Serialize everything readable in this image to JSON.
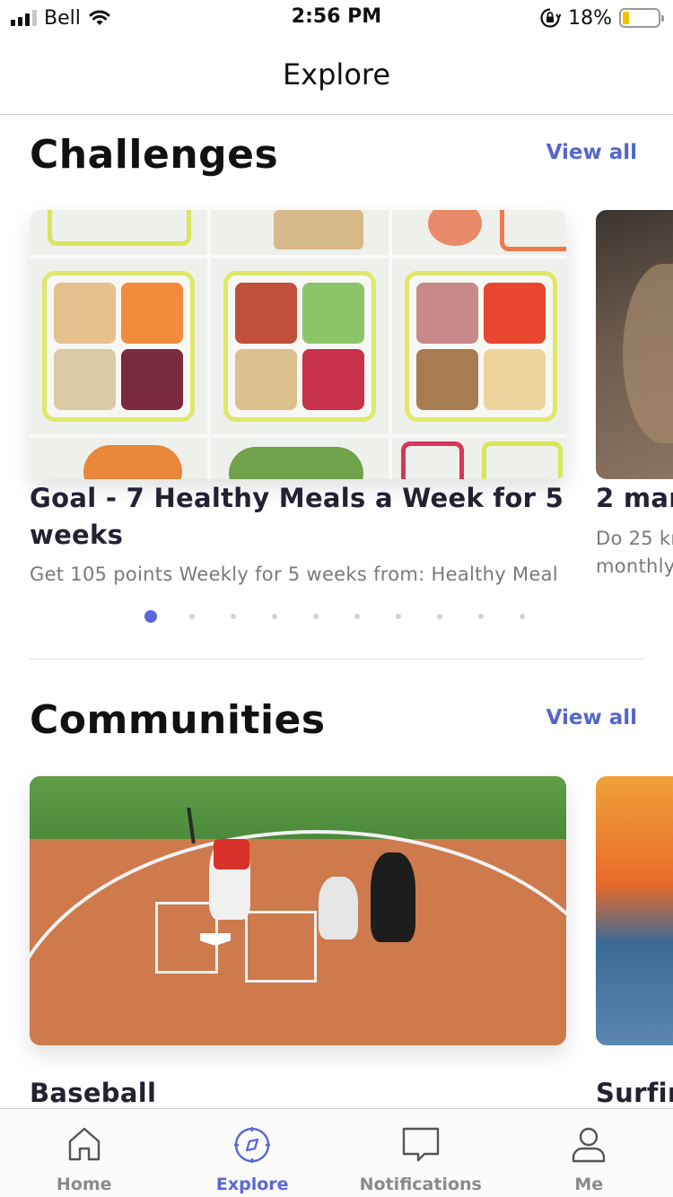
{
  "status_bar": {
    "carrier": "Bell",
    "time": "2:56 PM",
    "battery_percent_text": "18%",
    "battery_level": 0.18
  },
  "header": {
    "title": "Explore"
  },
  "challenges": {
    "title": "Challenges",
    "view_all": "View all",
    "cards": [
      {
        "title_line1": "Goal - 7 Healthy Meals a Week for 5",
        "title_line2": "weeks",
        "subtitle": "Get 105 points Weekly for 5 weeks from: Healthy Meal"
      },
      {
        "title_line1": "2 man",
        "subtitle_line1": "Do 25 kr",
        "subtitle_line2": "monthly"
      }
    ],
    "pagination": {
      "count": 10,
      "active_index": 0
    }
  },
  "communities": {
    "title": "Communities",
    "view_all": "View all",
    "cards": [
      {
        "title": "Baseball"
      },
      {
        "title": "Surfin"
      }
    ]
  },
  "tab_bar": {
    "tabs": [
      {
        "label": "Home",
        "icon": "home-icon"
      },
      {
        "label": "Explore",
        "icon": "compass-icon"
      },
      {
        "label": "Notifications",
        "icon": "chat-bubble-icon"
      },
      {
        "label": "Me",
        "icon": "person-icon"
      }
    ],
    "active_index": 1
  },
  "colors": {
    "accent": "#5a67d8",
    "link": "#5566cc",
    "battery_low": "#f2c200"
  }
}
